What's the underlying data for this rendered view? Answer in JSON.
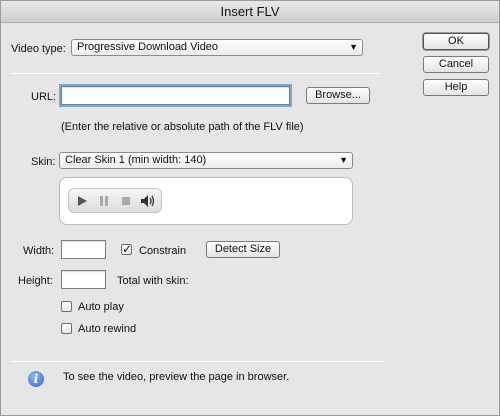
{
  "window": {
    "title": "Insert FLV"
  },
  "video_type": {
    "label": "Video type:",
    "selected": "Progressive Download Video"
  },
  "buttons": {
    "ok": "OK",
    "cancel": "Cancel",
    "help": "Help"
  },
  "url": {
    "label": "URL:",
    "value": "",
    "browse": "Browse...",
    "hint": "(Enter the relative or absolute path of the FLV file)"
  },
  "skin": {
    "label": "Skin:",
    "selected": "Clear Skin 1 (min width: 140)"
  },
  "width": {
    "label": "Width:",
    "value": "",
    "constrain_label": "Constrain",
    "constrain_checked": true,
    "detect_size": "Detect Size"
  },
  "height": {
    "label": "Height:",
    "value": "",
    "total_label": "Total with skin:"
  },
  "options": {
    "auto_play": "Auto play",
    "auto_rewind": "Auto rewind"
  },
  "footer": {
    "info_text": "To see the video, preview the page in browser."
  },
  "icons": {
    "check": "✓",
    "dropdown": "▼",
    "info": "i"
  }
}
